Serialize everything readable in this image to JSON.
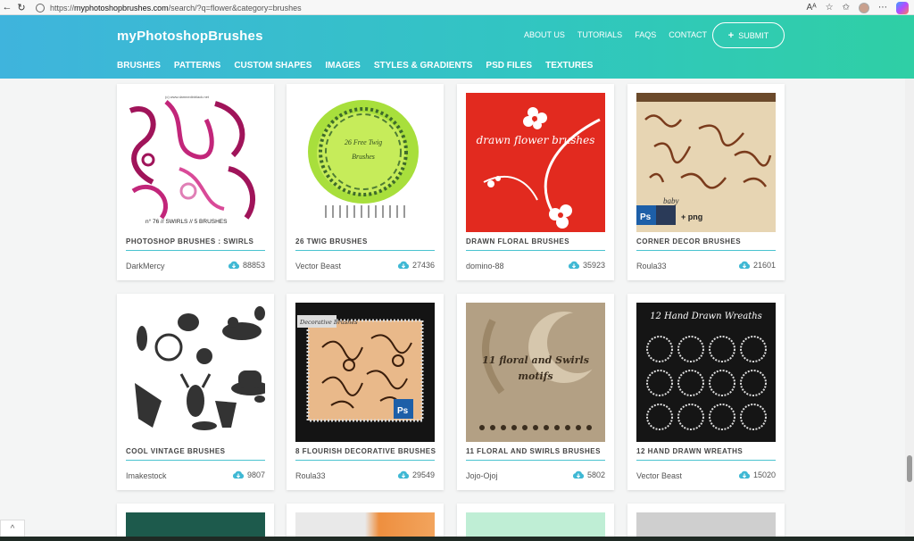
{
  "browser": {
    "url_prefix": "https://",
    "url_host": "myphotoshopbrushes.com",
    "url_path": "/search/?q=flower&category=brushes"
  },
  "header": {
    "brand": "myPhotoshopBrushes",
    "links": [
      "ABOUT US",
      "TUTORIALS",
      "FAQS",
      "CONTACT"
    ],
    "submit_label": "SUBMIT",
    "categories": [
      "BRUSHES",
      "PATTERNS",
      "CUSTOM SHAPES",
      "IMAGES",
      "STYLES & GRADIENTS",
      "PSD FILES",
      "TEXTURES"
    ]
  },
  "cards": [
    {
      "title": "PHOTOSHOP BRUSHES : SWIRLS",
      "author": "DarkMercy",
      "downloads": "88853",
      "thumb_text": "n° 76 // SWIRLS // 5 BRUSHES",
      "thumb_note": "(c) www.damnedinblack.net"
    },
    {
      "title": "26 TWIG BRUSHES",
      "author": "Vector Beast",
      "downloads": "27436",
      "thumb_text": "26 Free Twig Brushes"
    },
    {
      "title": "DRAWN FLORAL BRUSHES",
      "author": "domino-88",
      "downloads": "35923",
      "thumb_text": "drawn flower brushes"
    },
    {
      "title": "CORNER DECOR BRUSHES",
      "author": "Roula33",
      "downloads": "21601",
      "thumb_text": "baby",
      "thumb_extra": "+ png"
    },
    {
      "title": "COOL VINTAGE BRUSHES",
      "author": "Imakestock",
      "downloads": "9807"
    },
    {
      "title": "8 FLOURISH DECORATIVE BRUSHES",
      "author": "Roula33",
      "downloads": "29549",
      "thumb_text": "Decorative Brushes"
    },
    {
      "title": "11 FLORAL AND SWIRLS BRUSHES",
      "author": "Jojo-Ojoj",
      "downloads": "5802",
      "thumb_text": "11 floral and Swirls motifs"
    },
    {
      "title": "12 HAND DRAWN WREATHS",
      "author": "Vector Beast",
      "downloads": "15020",
      "thumb_text": "12 Hand Drawn Wreaths"
    }
  ],
  "colors": {
    "accent": "#49c3cf",
    "download_icon": "#3fb8d4"
  }
}
